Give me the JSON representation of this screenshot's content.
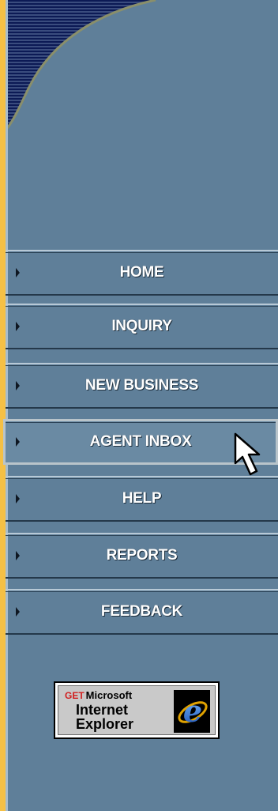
{
  "nav": {
    "items": [
      {
        "label": "HOME"
      },
      {
        "label": "INQUIRY"
      },
      {
        "label": "NEW BUSINESS"
      },
      {
        "label": "AGENT INBOX"
      },
      {
        "label": "HELP"
      },
      {
        "label": "REPORTS"
      },
      {
        "label": "FEEDBACK"
      }
    ],
    "active_item": "AGENT INBOX"
  },
  "badge": {
    "get": "GET",
    "microsoft": "Microsoft",
    "internet": "Internet",
    "explorer": "Explorer"
  },
  "colors": {
    "frame": "#f5c045",
    "panel": "#5f7f99",
    "label": "#ffffff"
  },
  "icons": [
    "nav-arrow-icon",
    "mouse-pointer-icon",
    "internet-explorer-logo-icon"
  ]
}
